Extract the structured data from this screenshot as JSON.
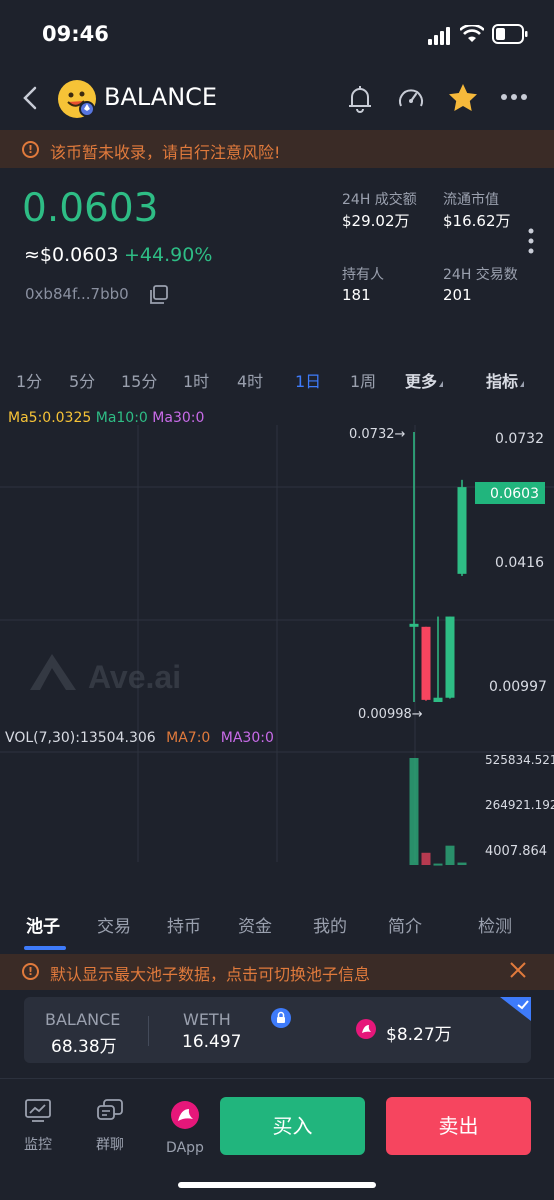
{
  "status": {
    "time": "09:46"
  },
  "header": {
    "token_name": "BALANCE"
  },
  "warning": {
    "text": "该币暂未收录，请自行注意风险!"
  },
  "price": {
    "main": "0.0603",
    "usd": "≈$0.0603",
    "change": "+44.90%",
    "address": "0xb84f...7bb0"
  },
  "stats": {
    "volume_label": "24H 成交额",
    "volume_value": "$29.02万",
    "mcap_label": "流通市值",
    "mcap_value": "$16.62万",
    "holders_label": "持有人",
    "holders_value": "181",
    "tx_label": "24H 交易数",
    "tx_value": "201"
  },
  "timeframes": {
    "items": [
      "1分",
      "5分",
      "15分",
      "1时",
      "4时",
      "1日",
      "1周"
    ],
    "active": "1日",
    "more_label": "更多",
    "indicator_label": "指标"
  },
  "chart_data": {
    "type": "candlestick",
    "ma_legend": {
      "ma5": "Ma5:0.0325",
      "ma10": "Ma10:0",
      "ma30": "Ma30:0"
    },
    "vol_legend": {
      "main": "VOL(7,30):13504.306",
      "ma7": "MA7:0",
      "ma30": "MA30:0"
    },
    "price_ticks": [
      "0.0732",
      "0.0416",
      "0.00997"
    ],
    "current_price_label": "0.0603",
    "high_marker": "0.0732→",
    "low_marker": "0.00998→",
    "volume_ticks": [
      "525834.521",
      "264921.192",
      "4007.864"
    ],
    "watermark": "Ave.ai",
    "colors": {
      "up": "#2ebd85",
      "down": "#f6455f"
    },
    "candles": [
      {
        "open": 0.0276,
        "high": 0.0732,
        "low": 0.01,
        "close": 0.0283,
        "volume": 525834
      },
      {
        "open": 0.0276,
        "high": 0.0276,
        "low": 0.0103,
        "close": 0.0105,
        "volume": 60000
      },
      {
        "open": 0.01,
        "high": 0.03,
        "low": 0.01,
        "close": 0.011,
        "volume": 7000
      },
      {
        "open": 0.011,
        "high": 0.03,
        "low": 0.0108,
        "close": 0.03,
        "volume": 95000
      },
      {
        "open": 0.04,
        "high": 0.062,
        "low": 0.0395,
        "close": 0.0603,
        "volume": 12000
      }
    ]
  },
  "tabs": {
    "items": [
      "池子",
      "交易",
      "持币",
      "资金",
      "我的",
      "简介",
      "检测"
    ],
    "active": "池子"
  },
  "pool_warning": {
    "text": "默认显示最大池子数据，点击可切换池子信息"
  },
  "pool": {
    "token_a_label": "BALANCE",
    "token_a_value": "68.38万",
    "token_b_label": "WETH",
    "token_b_value": "16.497",
    "liquidity": "$8.27万"
  },
  "bottom_nav": {
    "monitor": "监控",
    "group_chat": "群聊",
    "dapp": "DApp",
    "buy": "买入",
    "sell": "卖出"
  },
  "colors": {
    "accent": "#3e7bfa",
    "up": "#2ebd85",
    "down": "#f6455f",
    "warning": "#e07a3c"
  }
}
